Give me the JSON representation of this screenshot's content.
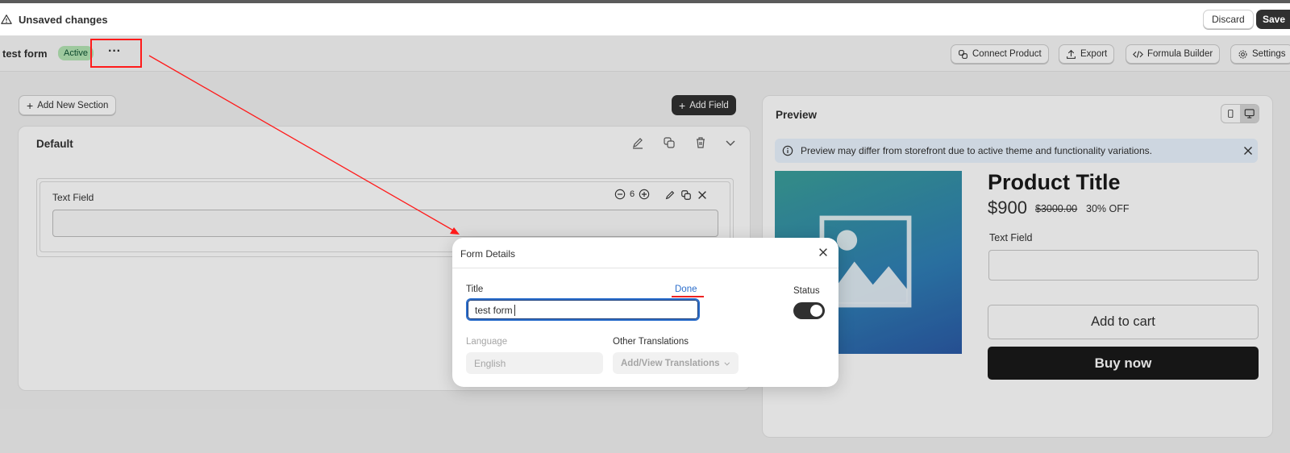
{
  "topbar": {
    "title": "Unsaved changes",
    "discard_label": "Discard",
    "save_label": "Save"
  },
  "header": {
    "form_name": "test form",
    "status_badge": "Active",
    "more_label": "···",
    "actions": {
      "connect_product": "Connect Product",
      "export": "Export",
      "formula_builder": "Formula Builder",
      "settings": "Settings"
    }
  },
  "builder": {
    "add_section_label": "Add New Section",
    "add_field_label": "Add Field",
    "section_title": "Default",
    "field": {
      "label": "Text Field",
      "width_value": "6"
    }
  },
  "preview": {
    "title": "Preview",
    "banner": "Preview may differ from storefront due to active theme and functionality variations.",
    "product_title": "Product Title",
    "price": "$900",
    "compare_price": "$3000.00",
    "discount": "30% OFF",
    "field_label": "Text Field",
    "add_to_cart": "Add to cart",
    "buy_now": "Buy now"
  },
  "modal": {
    "title": "Form Details",
    "title_label": "Title",
    "done_label": "Done",
    "title_value": "test form",
    "status_label": "Status",
    "status_on": true,
    "language_label": "Language",
    "language_value": "English",
    "translations_label": "Other Translations",
    "translations_button": "Add/View Translations"
  },
  "colors": {
    "annotation": "#ff1a1a",
    "accent": "#2c6ecb",
    "dark": "#303030"
  }
}
